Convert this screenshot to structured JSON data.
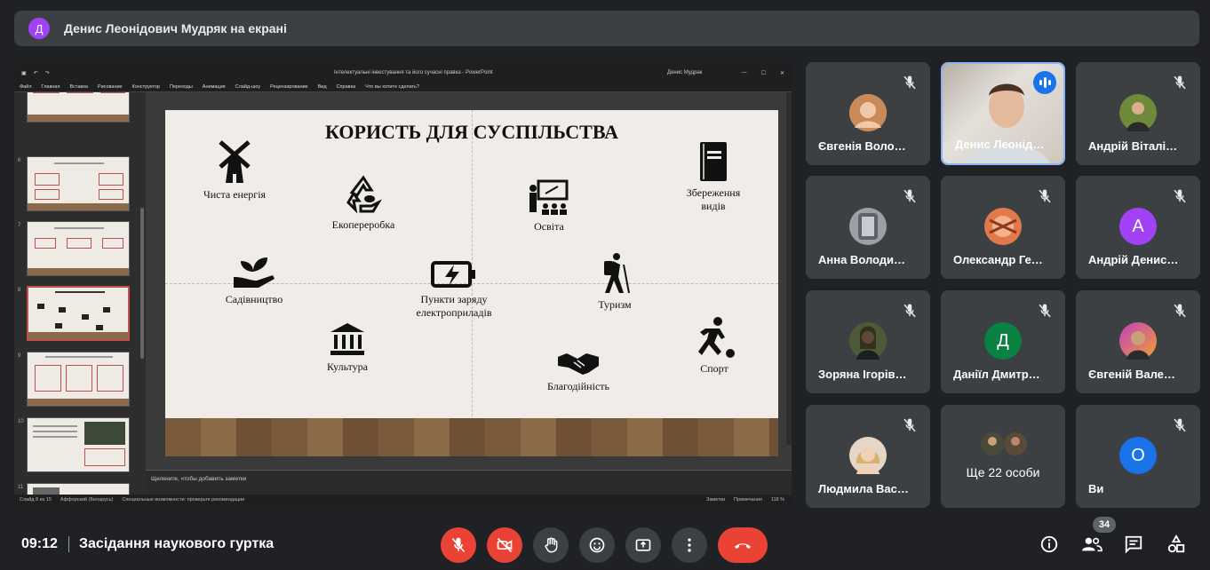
{
  "banner": {
    "avatar_letter": "Д",
    "text": "Денис Леонідович Мудряк на екрані"
  },
  "ppt": {
    "doc_title": "Інтелектуальні інвестування та його сучасні правка - PowerPoint",
    "user": "Денис Мудрак",
    "ribbon_tabs": [
      "Файл",
      "Главная",
      "Вставка",
      "Рисование",
      "Конструктор",
      "Переходы",
      "Анимация",
      "Слайд-шоу",
      "Рецензирование",
      "Вид",
      "Справка",
      "Что вы хотите сделать?"
    ],
    "thumb_numbers": [
      "6",
      "7",
      "8",
      "9",
      "10",
      "11"
    ],
    "notes_placeholder": "Щелкните, чтобы добавить заметки",
    "status_left": [
      "Слайд 8 из 15",
      "Аффорский (Беларусь)",
      "Специальные возможности: проверьте рекомендации"
    ],
    "status_right": [
      "Заметки",
      "Примечания",
      "118 %"
    ]
  },
  "slide": {
    "title": "КОРИСТЬ ДЛЯ СУСПІЛЬСТВА",
    "items": {
      "energy": "Чиста енергія",
      "recycle": "Екопереробка",
      "education": "Освіта",
      "storage_line1": "Збереження",
      "storage_line2": "видів",
      "gardening": "Садівництво",
      "charging_line1": "Пункти заряду",
      "charging_line2": "електроприладів",
      "tourism": "Туризм",
      "culture": "Культура",
      "charity": "Благодійність",
      "sport": "Спорт"
    }
  },
  "tiles": [
    {
      "name": "Євгенія Воло…"
    },
    {
      "name": "Денис Леонід…"
    },
    {
      "name": "Андрій Віталі…"
    },
    {
      "name": "Анна Володи…"
    },
    {
      "name": "Олександр Ге…"
    },
    {
      "name": "Андрій Денис…",
      "letter": "А"
    },
    {
      "name": "Зоряна Ігорів…"
    },
    {
      "name": "Даніїл Дмитр…",
      "letter": "Д"
    },
    {
      "name": "Євгеній Вале…"
    },
    {
      "name": "Людмила Вас…"
    },
    {
      "more": "Ще 22 особи"
    },
    {
      "name": "Ви",
      "letter": "О"
    }
  ],
  "bottom": {
    "time": "09:12",
    "meeting_title": "Засідання наукового гуртка",
    "participants_count": "34"
  },
  "colors": {
    "bg": "#202124",
    "tile": "#3c4043",
    "red": "#ea4335",
    "accent": "#8ab4f8",
    "avatar_a": "#a142f4",
    "avatar_d": "#0b8043",
    "avatar_o": "#1a73e8"
  }
}
